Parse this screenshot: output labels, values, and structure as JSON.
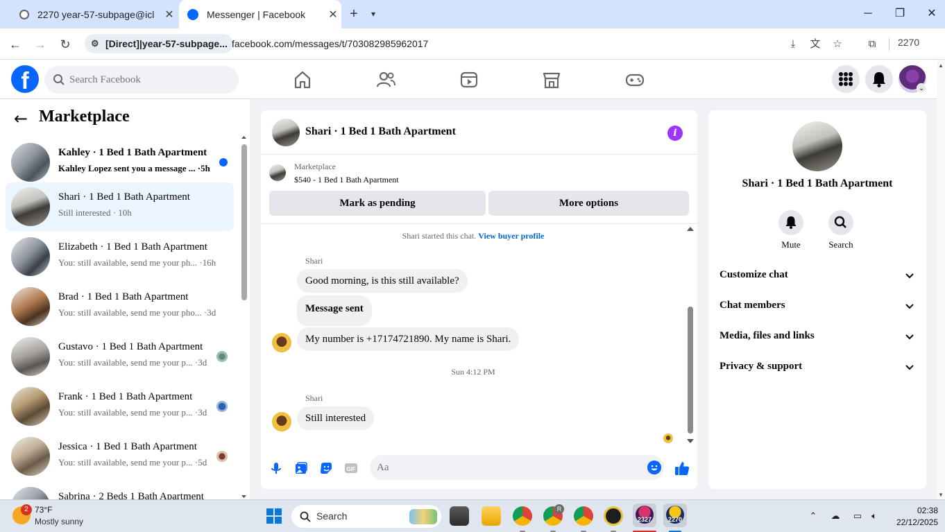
{
  "browser": {
    "tabs": [
      {
        "title": "2270 year-57-subpage@icl",
        "favicon": "globe-icon"
      },
      {
        "title": "Messenger | Facebook",
        "favicon": "facebook-icon"
      }
    ],
    "site_chip": "[Direct]|year-57-subpage...",
    "url": "facebook.com/messages/t/703082985962017",
    "profile_label": "2270"
  },
  "facebook": {
    "search_placeholder": "Search Facebook",
    "brand_color": "#0866ff"
  },
  "left_panel": {
    "title": "Marketplace",
    "conversations": [
      {
        "name": "Kahley · 1 Bed 1 Bath Apartment",
        "preview": "Kahley Lopez sent you a message ... ·5h",
        "unread": true,
        "thumb": "kitchen-grey"
      },
      {
        "name": "Shari · 1 Bed 1 Bath Apartment",
        "preview": "Still interested · 10h",
        "active": true,
        "thumb": "kitchen-dark"
      },
      {
        "name": "Elizabeth · 1 Bed 1 Bath Apartment",
        "preview": "You: still available, send me your ph... ·16h",
        "thumb": "kitchen-grey"
      },
      {
        "name": "Brad · 1 Bed 1 Bath Apartment",
        "preview": "You: still available, send me your pho... ·3d",
        "thumb": "dining-warm"
      },
      {
        "name": "Gustavo · 1 Bed 1 Bath Apartment",
        "preview": "You: still available, send me your p... ·3d",
        "thumb": "living-grey"
      },
      {
        "name": "Frank · 1 Bed 1 Bath Apartment",
        "preview": "You: still available, send me your p... ·3d",
        "thumb": "living-warm"
      },
      {
        "name": "Jessica · 1 Bed 1 Bath Apartment",
        "preview": "You: still available, send me your p... ·5d",
        "thumb": "living-beige"
      },
      {
        "name": "Sabrina · 2 Beds 1 Bath Apartment",
        "preview": "",
        "thumb": "kitchen-grey"
      }
    ]
  },
  "chat": {
    "title": "Shari · 1 Bed 1 Bath Apartment",
    "marketplace_label": "Marketplace",
    "listing": "$540 - 1 Bed 1 Bath Apartment",
    "mark_pending": "Mark as pending",
    "more_options": "More options",
    "started_text": "Shari started this chat.",
    "view_profile": "View buyer profile",
    "sender": "Shari",
    "messages": [
      "Good morning, is this still available?",
      "Message sent",
      "My number is +17174721890. My name is Shari."
    ],
    "timestamp": "Sun 4:12 PM",
    "sender2": "Shari",
    "last_message": "Still interested",
    "composer_placeholder": "Aa",
    "accent": "#a033ff"
  },
  "right_panel": {
    "title": "Shari · 1 Bed 1 Bath Apartment",
    "actions": [
      "Mute",
      "Search"
    ],
    "sections": [
      "Customize chat",
      "Chat members",
      "Media, files and links",
      "Privacy & support"
    ]
  },
  "taskbar": {
    "weather_temp": "73°F",
    "weather_desc": "Mostly sunny",
    "weather_badge": "2",
    "search_label": "Search",
    "time": "02:38",
    "date": "22/12/2025",
    "app_badges": [
      "R",
      "2327",
      "2270"
    ]
  }
}
